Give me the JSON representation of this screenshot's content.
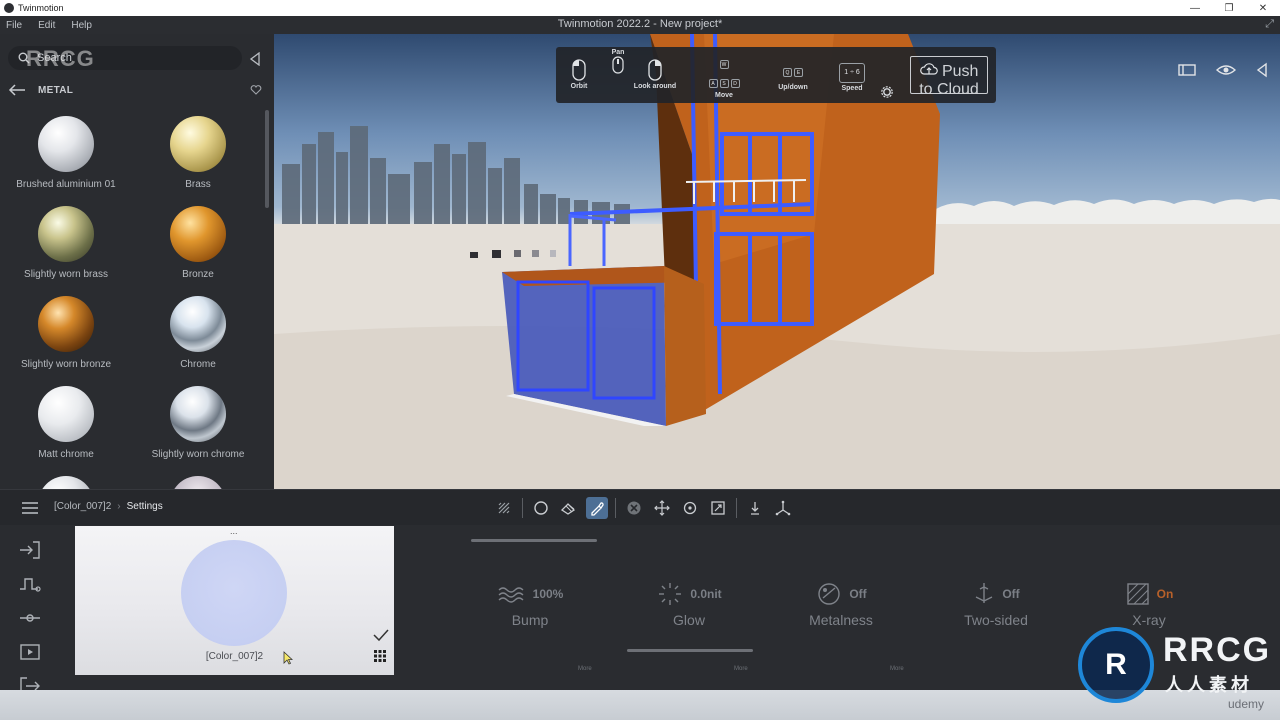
{
  "window": {
    "app_name": "Twinmotion",
    "title": "Twinmotion 2022.2 - New project*",
    "minimize_glyph": "—",
    "maximize_glyph": "❐",
    "close_glyph": "✕"
  },
  "menu": {
    "items": [
      "File",
      "Edit",
      "Help"
    ]
  },
  "library": {
    "search_placeholder": "Search",
    "category": "METAL",
    "materials": [
      {
        "label": "Brushed aluminium 01",
        "icon": "brushed-aluminium-sphere"
      },
      {
        "label": "Brass",
        "icon": "brass-sphere"
      },
      {
        "label": "Slightly worn brass",
        "icon": "slightly-worn-brass-sphere"
      },
      {
        "label": "Bronze",
        "icon": "bronze-sphere"
      },
      {
        "label": "Slightly worn bronze",
        "icon": "slightly-worn-bronze-sphere"
      },
      {
        "label": "Chrome",
        "icon": "chrome-sphere"
      },
      {
        "label": "Matt chrome",
        "icon": "matt-chrome-sphere"
      },
      {
        "label": "Slightly worn chrome",
        "icon": "slightly-worn-chrome-sphere"
      }
    ]
  },
  "navigation": {
    "pan_label": "Pan",
    "orbit_label": "Orbit",
    "look_around_label": "Look around",
    "move_label": "Move",
    "updown_label": "Up/down",
    "speed_label": "Speed",
    "speed_value": "1 ÷ 6",
    "push_to_cloud_label": "Push to Cloud",
    "keys": {
      "w": "W",
      "a": "A",
      "s": "S",
      "d": "D",
      "q": "Q",
      "e": "E",
      "w_sub": "Z",
      "a_sub": "Q",
      "s_sub": "S",
      "d_sub": "D",
      "q_sub": "A",
      "e_sub": "E"
    }
  },
  "toolbar": {
    "breadcrumb": [
      "[Color_007]2",
      "Settings"
    ]
  },
  "preview": {
    "dots": "...",
    "material_name": "[Color_007]2",
    "swatch_color": "#c8d0f3"
  },
  "properties": [
    {
      "name": "Bump",
      "value": "100%",
      "icon": "bump-icon"
    },
    {
      "name": "Glow",
      "value": "0.0nit",
      "icon": "glow-icon"
    },
    {
      "name": "Metalness",
      "value": "Off",
      "icon": "metalness-icon"
    },
    {
      "name": "Two-sided",
      "value": "Off",
      "icon": "two-sided-icon"
    },
    {
      "name": "X-ray",
      "value": "On",
      "icon": "x-ray-icon"
    }
  ],
  "more_label": "More",
  "colors": {
    "accent": "#4d6f95",
    "xray_on": "#b8612a",
    "building_orange": "#c56a1a",
    "selection_blue": "#3d5cff"
  },
  "watermark": {
    "brand": "RRCG",
    "brand_cn": "人人素材",
    "platform": "udemy"
  }
}
